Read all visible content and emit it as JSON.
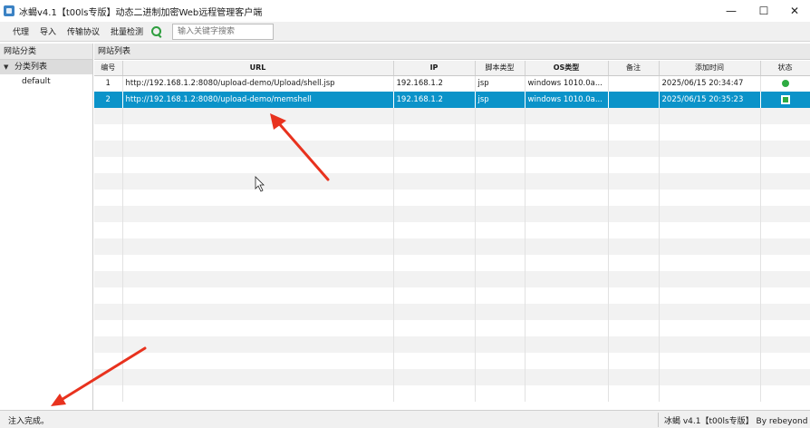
{
  "window": {
    "title": "冰蝎v4.1【t00ls专版】动态二进制加密Web远程管理客户端",
    "minimize": "—",
    "maximize": "☐",
    "close": "✕"
  },
  "toolbar": {
    "items": [
      "代理",
      "导入",
      "传输协议",
      "批量检测"
    ],
    "search_placeholder": "输入关键字搜索"
  },
  "left_panel": {
    "header": "网站分类",
    "tree_parent": "分类列表",
    "tree_children": [
      "default"
    ]
  },
  "right_panel": {
    "header": "网站列表",
    "columns": [
      "编号",
      "URL",
      "IP",
      "脚本类型",
      "OS类型",
      "备注",
      "添加时间",
      "状态"
    ],
    "rows": [
      {
        "id": "1",
        "url": "http://192.168.1.2:8080/upload-demo/Upload/shell.jsp",
        "ip": "192.168.1.2",
        "script": "jsp",
        "os": "windows 1010.0a...",
        "note": "",
        "time": "2025/06/15 20:34:47",
        "status": "online"
      },
      {
        "id": "2",
        "url": "http://192.168.1.2:8080/upload-demo/memshell",
        "ip": "192.168.1.2",
        "script": "jsp",
        "os": "windows 1010.0a...",
        "note": "",
        "time": "2025/06/15 20:35:23",
        "status": "online"
      }
    ]
  },
  "statusbar": {
    "left": "注入完成。",
    "right": "冰蝎 v4.1【t00ls专版】 By rebeyond"
  },
  "colors": {
    "selection": "#0b93c9",
    "status_green": "#2eab42",
    "arrow_red": "#e8321e"
  }
}
